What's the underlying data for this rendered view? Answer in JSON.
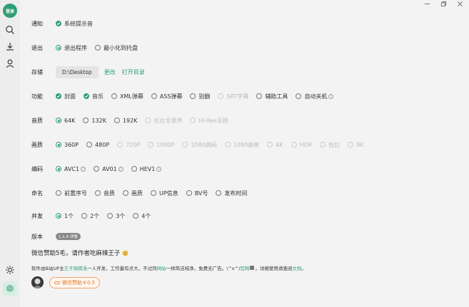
{
  "sidebar": {
    "login_label": "登录",
    "icons": [
      "search-icon",
      "download-icon",
      "user-icon",
      "theme-sun-icon",
      "settings-icon"
    ]
  },
  "window_controls": [
    "minimize-icon",
    "restore-icon",
    "close-icon"
  ],
  "settings": {
    "notify": {
      "label": "通知",
      "options": [
        {
          "text": "系统提示音",
          "checked": true
        }
      ]
    },
    "exit": {
      "label": "退出",
      "options": [
        {
          "text": "退出程序",
          "selected": true
        },
        {
          "text": "最小化到托盘",
          "selected": false
        }
      ]
    },
    "storage": {
      "label": "存储",
      "path": "D:\\Desktop",
      "change": "更改",
      "open": "打开目录"
    },
    "features": {
      "label": "功能",
      "options": [
        {
          "text": "封面",
          "checked": true
        },
        {
          "text": "音乐",
          "checked": true
        },
        {
          "text": "XML弹幕",
          "checked": false
        },
        {
          "text": "ASS弹幕",
          "checked": false
        },
        {
          "text": "别删",
          "checked": false
        },
        {
          "text": "SRT字幕",
          "checked": false,
          "disabled": true
        },
        {
          "text": "辅助工具",
          "checked": false
        },
        {
          "text": "自动关机",
          "checked": false,
          "info": true
        }
      ]
    },
    "audio": {
      "label": "音质",
      "options": [
        {
          "text": "64K",
          "selected": true
        },
        {
          "text": "132K"
        },
        {
          "text": "192K"
        },
        {
          "text": "杜比全景声",
          "disabled": true
        },
        {
          "text": "Hi-Res无损",
          "disabled": true
        }
      ]
    },
    "video": {
      "label": "画质",
      "options": [
        {
          "text": "360P",
          "selected": true
        },
        {
          "text": "480P"
        },
        {
          "text": "720P",
          "disabled": true
        },
        {
          "text": "1080P",
          "disabled": true
        },
        {
          "text": "1080高码",
          "disabled": true
        },
        {
          "text": "1080高帧",
          "disabled": true
        },
        {
          "text": "4K",
          "disabled": true
        },
        {
          "text": "HDR",
          "disabled": true
        },
        {
          "text": "杜比",
          "disabled": true
        },
        {
          "text": "8K",
          "disabled": true
        }
      ]
    },
    "codec": {
      "label": "编码",
      "options": [
        {
          "text": "AVC1",
          "selected": true,
          "info": true
        },
        {
          "text": "AV01",
          "info": true
        },
        {
          "text": "HEV1",
          "info": true
        }
      ]
    },
    "naming": {
      "label": "命名",
      "options": [
        {
          "text": "前置序号"
        },
        {
          "text": "音质"
        },
        {
          "text": "画质"
        },
        {
          "text": "UP信息"
        },
        {
          "text": "BV号"
        },
        {
          "text": "发布时间"
        }
      ]
    },
    "concurrency": {
      "label": "并发",
      "options": [
        {
          "text": "1个",
          "selected": true
        },
        {
          "text": "2个"
        },
        {
          "text": "3个"
        },
        {
          "text": "4个"
        }
      ]
    },
    "version": {
      "label": "版本",
      "badge": "1.1.4 详情"
    }
  },
  "donation": {
    "title": "微信赞助5毛，请作者吃麻辣王子",
    "note_parts": [
      "软件由B站UP主",
      "王子周棋洛",
      "一人开发，工作量有点大，不过同",
      "网站",
      "一样简洁纯净，免费无广告。\\^o^/",
      "官网",
      "，详细使用请查阅",
      "文档",
      "。"
    ],
    "button": "微信赞助￥0.5"
  },
  "colors": {
    "accent": "#2f9e74",
    "donate": "#e07a2e"
  }
}
